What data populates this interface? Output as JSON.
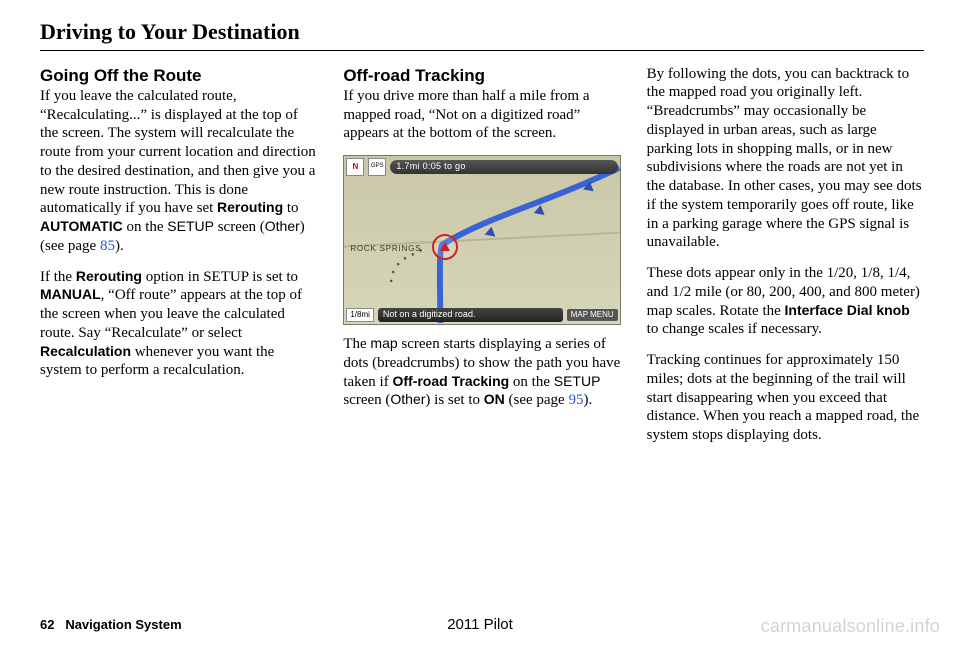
{
  "header": {
    "title": "Driving to Your Destination"
  },
  "col1": {
    "heading": "Going Off the Route",
    "p1a": "If you leave the calculated route, “Recalculating...” is displayed at the top of the screen. The system will recalculate the route from your current location and direction to the desired destination, and then give you a new route instruction. This is done automatically if you have set ",
    "rerouting": "Rerouting",
    "p1b": " to ",
    "automatic": "AUTOMATIC",
    "p1c": " on the ",
    "setup": "SETUP",
    "p1d": " screen (",
    "other": "Other",
    "p1e": ") (see page ",
    "page85": "85",
    "p1f": ").",
    "p2a": "If the ",
    "p2b": " option in SETUP is set to ",
    "manual": "MANUAL",
    "p2c": ", “Off route” appears at the top of the screen when you leave the calculated route. Say “Recalculate” or select ",
    "recalculation": "Recalculation",
    "p2d": " whenever you want the system to perform a recalculation."
  },
  "col2": {
    "heading": "Off-road Tracking",
    "p1": "If you drive more than half a mile from a mapped road, “Not on a digitized road” appears at the bottom of the screen.",
    "ss": {
      "north": "N",
      "gps": "GPS",
      "dist": "1.7mi  0:05 to go",
      "road": "ROCK SPRINGS",
      "scale": "1/8mi",
      "msg": "Not on a digitized road.",
      "menu": "MAP MENU"
    },
    "p2a": "The ",
    "map": "map",
    "p2b": " screen starts displaying a series of dots (breadcrumbs) to show the path you have taken if ",
    "offroad": "Off-road Tracking",
    "p2c": " on the ",
    "setup": "SETUP",
    "p2d": " screen (",
    "other": "Other",
    "p2e": ") is set to ",
    "on": "ON",
    "p2f": " (see page ",
    "page95": "95",
    "p2g": ")."
  },
  "col3": {
    "p1": "By following the dots, you can backtrack to the mapped road you originally left. “Breadcrumbs” may occasionally be displayed in urban areas, such as large parking lots in shopping malls, or in new subdivisions where the roads are not yet in the database. In other cases, you may see dots if the system temporarily goes off route, like in a parking garage where the GPS signal is unavailable.",
    "p2a": "These dots appear only in the 1/20, 1/8, 1/4, and 1/2 mile (or 80, 200, 400, and 800 meter) map scales. Rotate the ",
    "knob": "Interface Dial knob",
    "p2b": " to change scales if necessary.",
    "p3": "Tracking continues for approximately 150 miles; dots at the beginning of the trail will start disappearing when you exceed that distance. When you reach a mapped road, the system stops displaying dots."
  },
  "footer": {
    "pagenum": "62",
    "section": "Navigation System",
    "model": "2011 Pilot",
    "watermark": "carmanualsonline.info"
  }
}
